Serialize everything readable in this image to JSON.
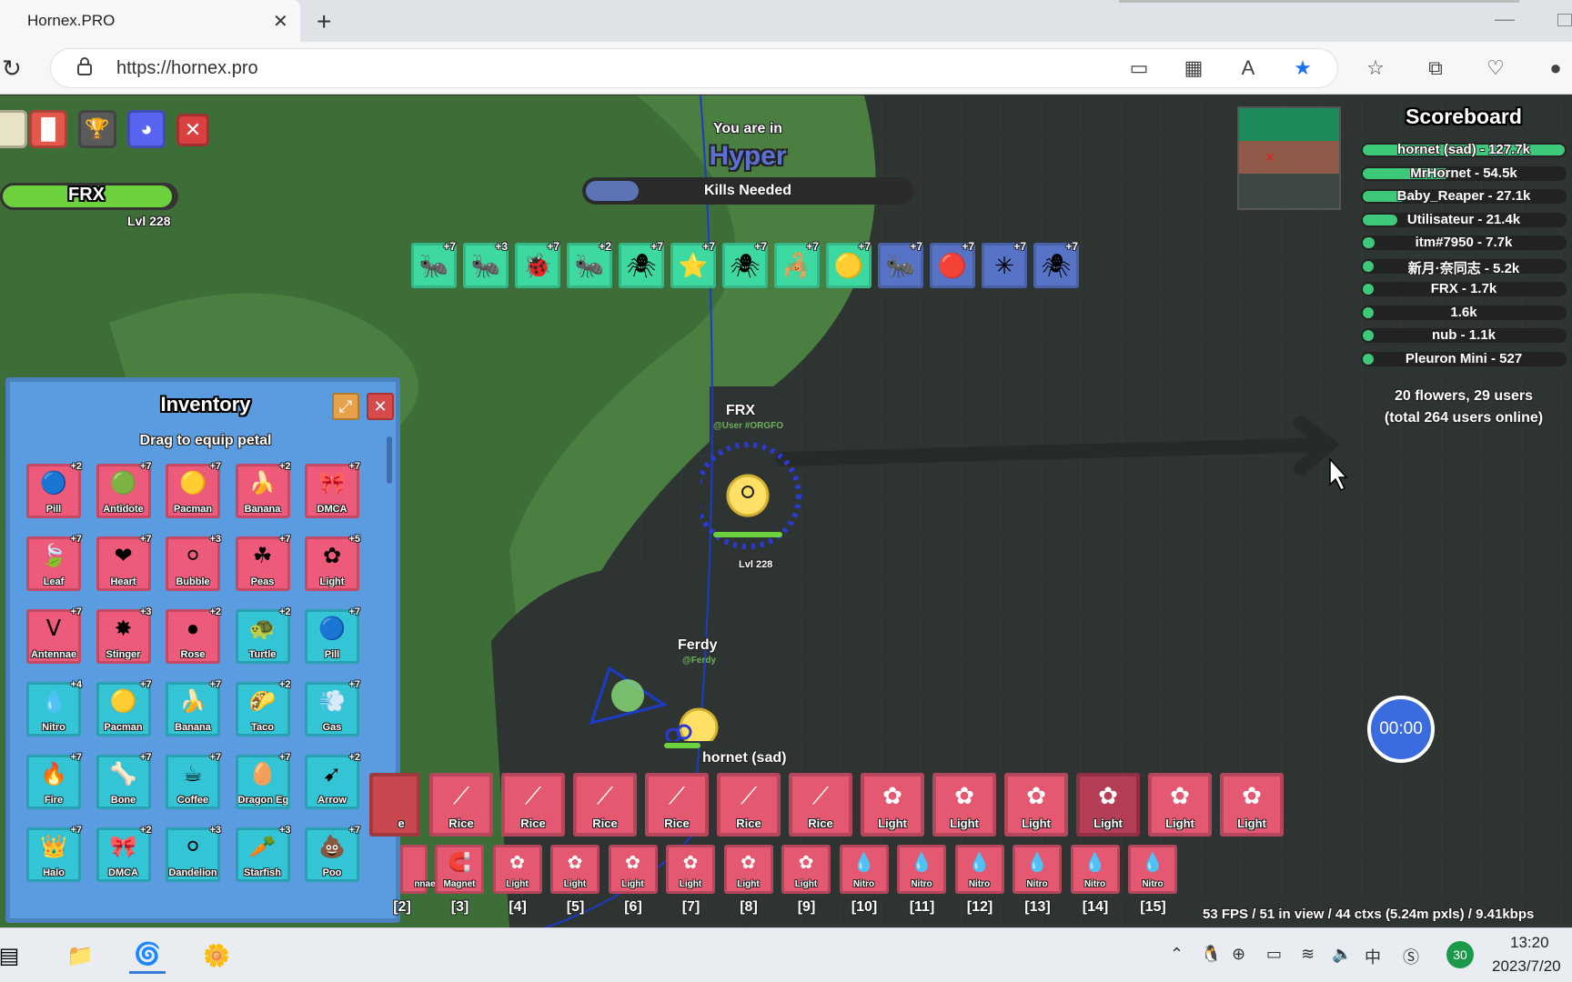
{
  "browser": {
    "tab_title": "Hornex.PRO",
    "url": "https://hornex.pro"
  },
  "player": {
    "name": "FRX",
    "level": "Lvl 228"
  },
  "zone": {
    "label": "You are in",
    "name": "Hyper",
    "kills_text": "Kills Needed"
  },
  "mob_tiles": [
    {
      "icon": "🐜",
      "count": "+7",
      "color": "#3ed9a0"
    },
    {
      "icon": "🐜",
      "count": "+3",
      "color": "#3ed9a0"
    },
    {
      "icon": "🐞",
      "count": "+7",
      "color": "#3ed9a0"
    },
    {
      "icon": "🐜",
      "count": "+2",
      "color": "#3ed9a0"
    },
    {
      "icon": "🕷",
      "count": "+7",
      "color": "#3ed9a0"
    },
    {
      "icon": "⭐",
      "count": "+7",
      "color": "#3ed9a0"
    },
    {
      "icon": "🕷",
      "count": "+7",
      "color": "#3ed9a0"
    },
    {
      "icon": "🦂",
      "count": "+7",
      "color": "#3ed9a0"
    },
    {
      "icon": "🟡",
      "count": "+7",
      "color": "#3ed9a0"
    },
    {
      "icon": "🐜",
      "count": "+7",
      "color": "#5673c5"
    },
    {
      "icon": "🔴",
      "count": "+7",
      "color": "#5673c5"
    },
    {
      "icon": "✳",
      "count": "+7",
      "color": "#5673c5"
    },
    {
      "icon": "🕷",
      "count": "+7",
      "color": "#5673c5"
    }
  ],
  "scoreboard": {
    "title": "Scoreboard",
    "entries": [
      {
        "label": "hornet (sad) - 127.7k",
        "fraction": 1.0
      },
      {
        "label": "MrHornet - 54.5k",
        "fraction": 0.43
      },
      {
        "label": "Baby_Reaper - 27.1k",
        "fraction": 0.21
      },
      {
        "label": "Utilisateur - 21.4k",
        "fraction": 0.17
      },
      {
        "label": "itm#7950 - 7.7k",
        "fraction": 0.06
      },
      {
        "label": "新月·奈同志 - 5.2k",
        "fraction": 0.04
      },
      {
        "label": "FRX - 1.7k",
        "fraction": 0.013
      },
      {
        "label": "1.6k",
        "fraction": 0.012
      },
      {
        "label": "nub - 1.1k",
        "fraction": 0.009
      },
      {
        "label": "Pleuron Mini - 527",
        "fraction": 0.004
      }
    ],
    "footer_line1": "20 flowers, 29 users",
    "footer_line2": "(total 264 users online)"
  },
  "game_labels": {
    "frx_name": "FRX",
    "frx_tag": "@User #ORGFO",
    "frx_level": "Lvl 228",
    "ferdy_name": "Ferdy",
    "ferdy_tag": "@Ferdy",
    "hornet_name": "hornet (sad)"
  },
  "timer": "00:00",
  "fps_text": "53 FPS / 51 in view / 44 ctxs (5.24m pxls) / 9.41kbps",
  "inventory": {
    "title": "Inventory",
    "subtitle": "Drag to equip petal",
    "petals": [
      {
        "name": "Pill",
        "icon": "🔵",
        "count": "+2",
        "color": "#ee5a7a"
      },
      {
        "name": "Antidote",
        "icon": "🟢",
        "count": "+7",
        "color": "#ee5a7a"
      },
      {
        "name": "Pacman",
        "icon": "🟡",
        "count": "+7",
        "color": "#ee5a7a"
      },
      {
        "name": "Banana",
        "icon": "🍌",
        "count": "+2",
        "color": "#ee5a7a"
      },
      {
        "name": "DMCA",
        "icon": "🎀",
        "count": "+7",
        "color": "#ee5a7a"
      },
      {
        "name": "Leaf",
        "icon": "🍃",
        "count": "+7",
        "color": "#ee5a7a"
      },
      {
        "name": "Heart",
        "icon": "❤",
        "count": "+7",
        "color": "#ee5a7a"
      },
      {
        "name": "Bubble",
        "icon": "⚪",
        "count": "+3",
        "color": "#ee5a7a"
      },
      {
        "name": "Peas",
        "icon": "☘",
        "count": "+7",
        "color": "#ee5a7a"
      },
      {
        "name": "Light",
        "icon": "✿",
        "count": "+5",
        "color": "#ee5a7a"
      },
      {
        "name": "Antennae",
        "icon": "ᐯ",
        "count": "+7",
        "color": "#ee5a7a"
      },
      {
        "name": "Stinger",
        "icon": "✸",
        "count": "+3",
        "color": "#ee5a7a"
      },
      {
        "name": "Rose",
        "icon": "●",
        "count": "+2",
        "color": "#ee5a7a"
      },
      {
        "name": "Turtle",
        "icon": "🐢",
        "count": "+2",
        "color": "#33c4d6"
      },
      {
        "name": "Pill",
        "icon": "🔵",
        "count": "+7",
        "color": "#33c4d6"
      },
      {
        "name": "Nitro",
        "icon": "💧",
        "count": "+4",
        "color": "#33c4d6"
      },
      {
        "name": "Pacman",
        "icon": "🟡",
        "count": "+7",
        "color": "#33c4d6"
      },
      {
        "name": "Banana",
        "icon": "🍌",
        "count": "+7",
        "color": "#33c4d6"
      },
      {
        "name": "Taco",
        "icon": "🌮",
        "count": "+2",
        "color": "#33c4d6"
      },
      {
        "name": "Gas",
        "icon": "💨",
        "count": "+7",
        "color": "#33c4d6"
      },
      {
        "name": "Fire",
        "icon": "🔥",
        "count": "+7",
        "color": "#33c4d6"
      },
      {
        "name": "Bone",
        "icon": "🦴",
        "count": "+7",
        "color": "#33c4d6"
      },
      {
        "name": "Coffee",
        "icon": "☕",
        "count": "+7",
        "color": "#33c4d6"
      },
      {
        "name": "Dragon Egg",
        "icon": "🥚",
        "count": "+7",
        "color": "#33c4d6"
      },
      {
        "name": "Arrow",
        "icon": "➹",
        "count": "+2",
        "color": "#33c4d6"
      },
      {
        "name": "Halo",
        "icon": "👑",
        "count": "+7",
        "color": "#33c4d6"
      },
      {
        "name": "DMCA",
        "icon": "🎀",
        "count": "+2",
        "color": "#33c4d6"
      },
      {
        "name": "Dandelion",
        "icon": "⚪",
        "count": "+3",
        "color": "#33c4d6"
      },
      {
        "name": "Starfish",
        "icon": "🥕",
        "count": "+3",
        "color": "#33c4d6"
      },
      {
        "name": "Poo",
        "icon": "💩",
        "count": "+7",
        "color": "#33c4d6"
      }
    ]
  },
  "hotbar_top": [
    {
      "name": "Rice",
      "icon": "⟋"
    },
    {
      "name": "Rice",
      "icon": "⟋"
    },
    {
      "name": "Rice",
      "icon": "⟋"
    },
    {
      "name": "Rice",
      "icon": "⟋"
    },
    {
      "name": "Rice",
      "icon": "⟋"
    },
    {
      "name": "Rice",
      "icon": "⟋"
    },
    {
      "name": "Light",
      "icon": "✿"
    },
    {
      "name": "Light",
      "icon": "✿"
    },
    {
      "name": "Light",
      "icon": "✿"
    },
    {
      "name": "Light",
      "icon": "✿"
    },
    {
      "name": "Light",
      "icon": "✿"
    },
    {
      "name": "Light",
      "icon": "✿"
    }
  ],
  "hotbar_bottom": [
    {
      "name": "Magnet",
      "icon": "🧲"
    },
    {
      "name": "Light",
      "icon": "✿"
    },
    {
      "name": "Light",
      "icon": "✿"
    },
    {
      "name": "Light",
      "icon": "✿"
    },
    {
      "name": "Light",
      "icon": "✿"
    },
    {
      "name": "Light",
      "icon": "✿"
    },
    {
      "name": "Light",
      "icon": "✿"
    },
    {
      "name": "Nitro",
      "icon": "💧"
    },
    {
      "name": "Nitro",
      "icon": "💧"
    },
    {
      "name": "Nitro",
      "icon": "💧"
    },
    {
      "name": "Nitro",
      "icon": "💧"
    },
    {
      "name": "Nitro",
      "icon": "💧"
    },
    {
      "name": "Nitro",
      "icon": "💧"
    }
  ],
  "slot_numbers": [
    "[2]",
    "[3]",
    "[4]",
    "[5]",
    "[6]",
    "[7]",
    "[8]",
    "[9]",
    "[10]",
    "[11]",
    "[12]",
    "[13]",
    "[14]",
    "[15]"
  ],
  "taskbar": {
    "time": "13:20",
    "date": "2023/7/20",
    "tray_ime": "中",
    "tray_badge": "30"
  },
  "colors": {
    "rare_pink": "#ee5a7a",
    "cyan": "#33c4d6",
    "inventory_bg": "#5b9be0",
    "grass": "#3f7a3c"
  }
}
